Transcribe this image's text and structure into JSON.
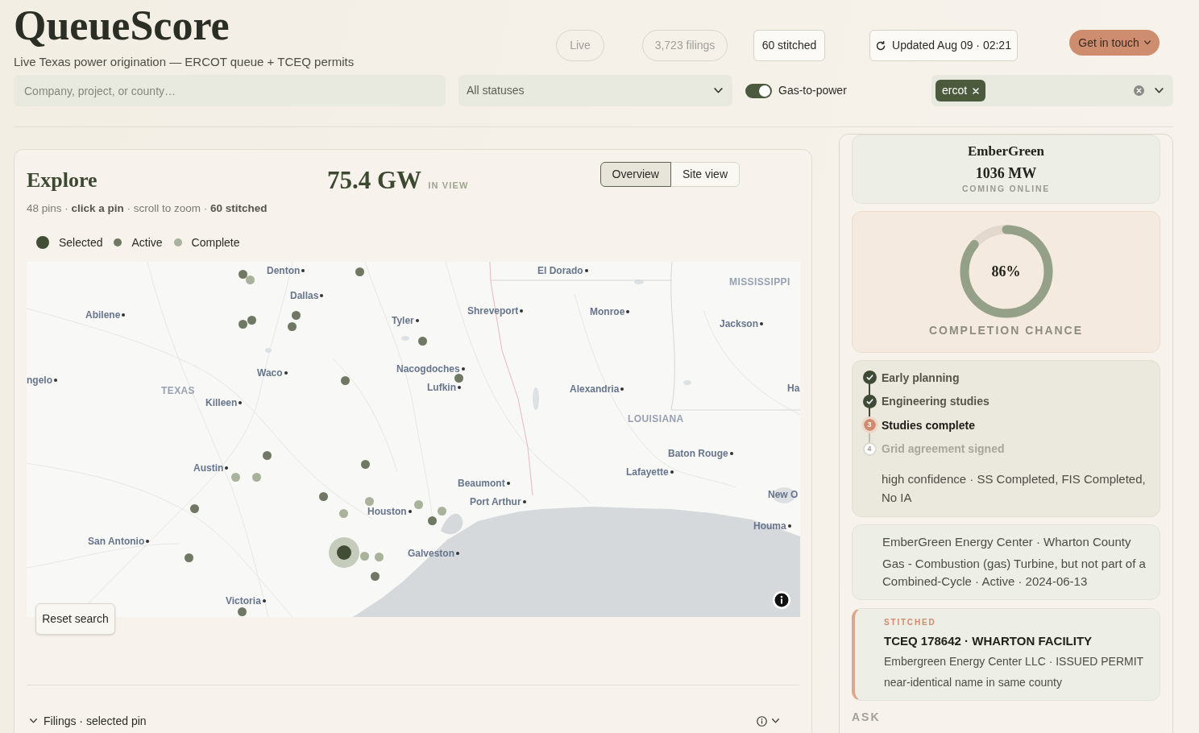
{
  "header": {
    "logo": "QueueScore",
    "tagline": "Live Texas power origination — ERCOT queue + TCEQ permits",
    "pills": [
      {
        "label": "Live",
        "kind": "ghost"
      },
      {
        "label": "3,723 filings",
        "kind": "ghost"
      },
      {
        "label": "60 stitched",
        "kind": "solid"
      },
      {
        "label": "Updated Aug 09 · 02:21",
        "kind": "refresh"
      }
    ],
    "cta": "Get in touch"
  },
  "filters": {
    "search": {
      "placeholder": "Company, project, or county…"
    },
    "status_select": {
      "value": "All statuses"
    },
    "gas_toggle": {
      "label": "Gas-to-power",
      "on": true
    },
    "market_select": {
      "chips": [
        "ercot"
      ]
    }
  },
  "explore": {
    "title": "Explore",
    "total": "75.4 GW",
    "total_caption": "IN VIEW",
    "views": [
      {
        "label": "Overview",
        "selected": true
      },
      {
        "label": "Site view",
        "selected": false
      }
    ],
    "summary": "48 pins · **click a pin** · scroll to zoom · **60 stitched**",
    "legend": [
      {
        "label": "Selected",
        "kind": "selected",
        "color": "#424d36"
      },
      {
        "label": "Active",
        "kind": "active",
        "color": "#6e7862"
      },
      {
        "label": "Complete",
        "kind": "completed",
        "color": "#a9b29b"
      }
    ],
    "map": {
      "labels": [
        {
          "text": "Denton",
          "kind": "city"
        },
        {
          "text": "El Dorado",
          "kind": "city"
        },
        {
          "text": "MISSISSIPPI",
          "kind": "region"
        },
        {
          "text": "Dallas",
          "kind": "city"
        },
        {
          "text": "Abilene",
          "kind": "city"
        },
        {
          "text": "Shreveport",
          "kind": "city"
        },
        {
          "text": "Monroe",
          "kind": "city"
        },
        {
          "text": "Tyler",
          "kind": "city"
        },
        {
          "text": "Jackson",
          "kind": "city"
        },
        {
          "text": "Waco",
          "kind": "city"
        },
        {
          "text": "Nacogdoches",
          "kind": "city"
        },
        {
          "text": "ngelo",
          "kind": "city"
        },
        {
          "text": "TEXAS",
          "kind": "region"
        },
        {
          "text": "Lufkin",
          "kind": "city"
        },
        {
          "text": "Alexandria",
          "kind": "city"
        },
        {
          "text": "Ha",
          "kind": "edge"
        },
        {
          "text": "Killeen",
          "kind": "city"
        },
        {
          "text": "LOUISIANA",
          "kind": "region"
        },
        {
          "text": "Baton Rouge",
          "kind": "city"
        },
        {
          "text": "Austin",
          "kind": "city"
        },
        {
          "text": "Lafayette",
          "kind": "city"
        },
        {
          "text": "Beaumont",
          "kind": "city"
        },
        {
          "text": "New O",
          "kind": "edge"
        },
        {
          "text": "Port Arthur",
          "kind": "city"
        },
        {
          "text": "Houston",
          "kind": "city"
        },
        {
          "text": "Houma",
          "kind": "city"
        },
        {
          "text": "San Antonio",
          "kind": "city"
        },
        {
          "text": "Galveston",
          "kind": "city"
        },
        {
          "text": "Victoria",
          "kind": "city"
        }
      ],
      "pins": [
        {
          "kind": "active"
        },
        {
          "kind": "completed"
        },
        {
          "kind": "active"
        },
        {
          "kind": "active"
        },
        {
          "kind": "active"
        },
        {
          "kind": "active"
        },
        {
          "kind": "active"
        },
        {
          "kind": "active"
        },
        {
          "kind": "active"
        },
        {
          "kind": "active"
        },
        {
          "kind": "active"
        },
        {
          "kind": "active"
        },
        {
          "kind": "completed"
        },
        {
          "kind": "completed"
        },
        {
          "kind": "active"
        },
        {
          "kind": "active"
        },
        {
          "kind": "completed"
        },
        {
          "kind": "completed"
        },
        {
          "kind": "completed"
        },
        {
          "kind": "completed"
        },
        {
          "kind": "active"
        },
        {
          "kind": "completed"
        },
        {
          "kind": "completed"
        },
        {
          "kind": "active"
        },
        {
          "kind": "active"
        },
        {
          "kind": "active"
        },
        {
          "kind": "selected"
        }
      ]
    },
    "reset_button": "Reset search",
    "filings_title": "Filings · selected pin"
  },
  "detail": {
    "name": "EmberGreen",
    "capacity": "1036 MW",
    "phase": "COMING ONLINE",
    "completion": {
      "value": "86%",
      "level": 0.86,
      "caption": "COMPLETION CHANCE"
    },
    "steps": [
      {
        "label": "Early planning",
        "completed": true,
        "current": false
      },
      {
        "label": "Engineering studies",
        "completed": true,
        "current": false
      },
      {
        "label": "Studies complete",
        "completed": false,
        "current": true,
        "number": "3"
      },
      {
        "label": "Grid agreement signed",
        "completed": false,
        "current": false,
        "number": "4"
      }
    ],
    "confidence_note": "high confidence · SS Completed, FIS Completed, No IA",
    "project": {
      "title": "EmberGreen Energy Center · Wharton County",
      "description": "Gas - Combustion (gas) Turbine, but not part of a Combined-Cycle · Active · 2024-06-13"
    },
    "stitched": {
      "tag": "STITCHED",
      "title": "TCEQ 178642 · WHARTON FACILITY",
      "subtitle": "Embergreen Energy Center LLC · ISSUED PERMIT",
      "note": "near-identical name in same county"
    },
    "ask_heading": "ASK"
  }
}
